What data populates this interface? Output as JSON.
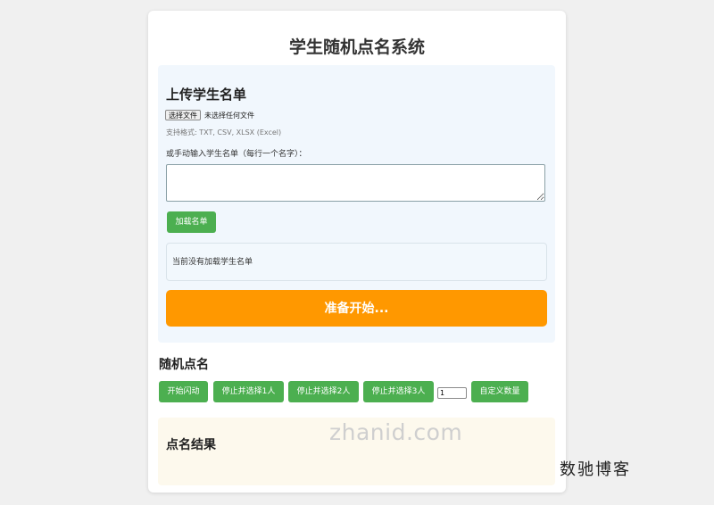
{
  "page": {
    "title": "学生随机点名系统"
  },
  "upload": {
    "title": "上传学生名单",
    "file_button": "选择文件",
    "file_status": "未选择任何文件",
    "formats": "支持格式: TXT, CSV, XLSX (Excel)",
    "manual_label": "或手动输入学生名单（每行一个名字）：",
    "textarea_value": "",
    "load_button": "加载名单",
    "status": "当前没有加载学生名单",
    "ready_button": "准备开始..."
  },
  "rollcall": {
    "title": "随机点名",
    "buttons": [
      "开始闪动",
      "停止并选择1人",
      "停止并选择2人",
      "停止并选择3人"
    ],
    "count_value": "1",
    "custom_button": "自定义数量"
  },
  "result": {
    "title": "点名结果"
  },
  "watermarks": {
    "site": "zhanid.com",
    "blog": "数驰博客"
  },
  "colors": {
    "green": "#4caf50",
    "orange": "#ff9800",
    "upload_bg": "#f1f7fd",
    "result_bg": "#fdf9ed"
  }
}
